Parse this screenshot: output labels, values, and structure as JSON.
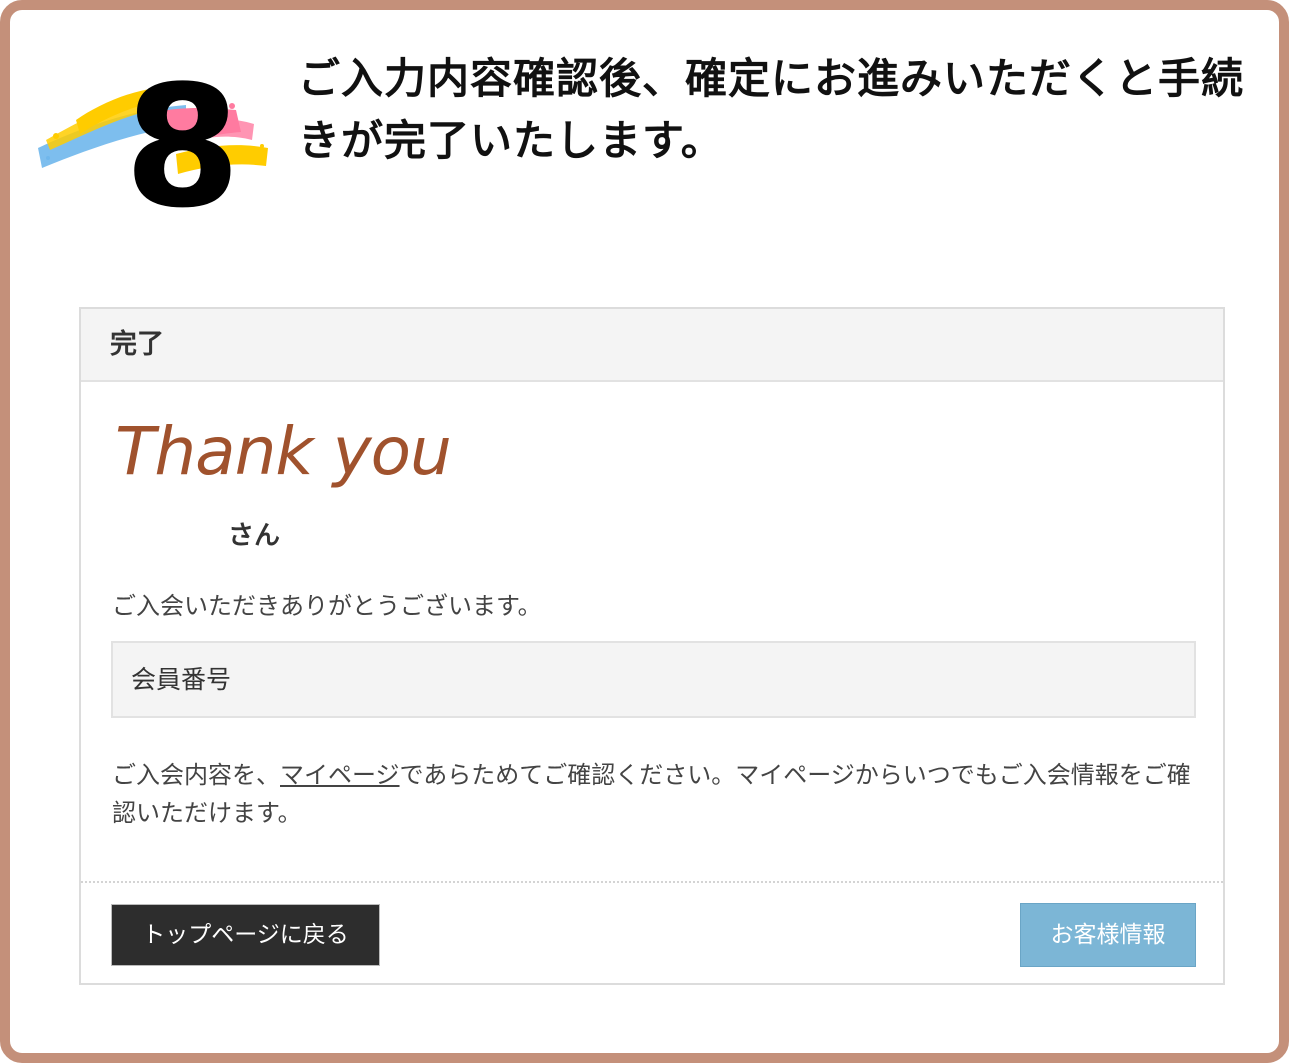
{
  "step": {
    "number": "8",
    "text": "ご入力内容確認後、確定にお進みいただくと手続きが完了いたします。"
  },
  "panel": {
    "title": "完了",
    "thanks": "Thank you",
    "username_suffix": "さん",
    "welcome": "ご入会いただきありがとうございます。",
    "member_label": "会員番号",
    "note_before": "ご入会内容を、",
    "note_link": "マイページ",
    "note_after": "であらためてご確認ください。マイページからいつでもご入会情報をご確認いただけます。",
    "buttons": {
      "top_page": "トップページに戻る",
      "customer_info": "お客様情報"
    }
  },
  "colors": {
    "frame_border": "#c4907a",
    "thanks_text": "#a0522d",
    "dark_button": "#2d2d2d",
    "info_button": "#7cb6d6",
    "brush_yellow": "#ffcc00",
    "brush_pink": "#ff7ba0",
    "brush_blue": "#6fb7ec"
  }
}
